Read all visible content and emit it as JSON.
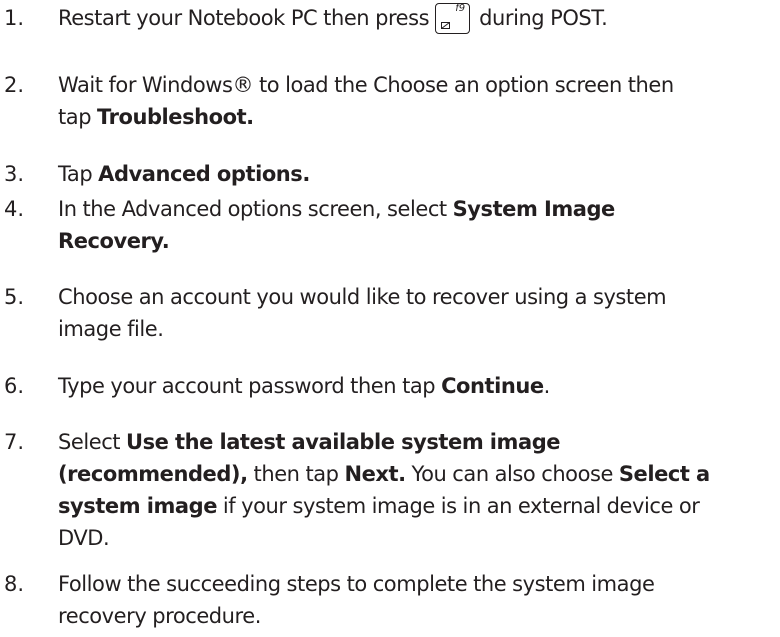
{
  "steps": [
    {
      "number": "1.",
      "lines": [
        {
          "before": "Restart your Notebook PC then press",
          "key": {
            "label": "f9",
            "icon": "fn-key-icon"
          },
          "after": "during POST."
        }
      ]
    },
    {
      "number": "2.",
      "lines": [
        {
          "plain": "Wait for Windows® to load the Choose an option screen then"
        },
        {
          "plain": "tap ",
          "bold": "Troubleshoot."
        }
      ]
    },
    {
      "number": "3.",
      "lines": [
        {
          "plain": "Tap ",
          "bold": "Advanced options."
        }
      ]
    },
    {
      "number": "4.",
      "lines": [
        {
          "plain": "In the Advanced options screen, select ",
          "bold": "System Image"
        },
        {
          "bold": "Recovery."
        }
      ]
    },
    {
      "number": "5.",
      "lines": [
        {
          "plain": "Choose an account you would like to recover using a system"
        },
        {
          "plain": "image file."
        }
      ]
    },
    {
      "number": "6.",
      "lines": [
        {
          "plain": "Type your account password then tap ",
          "bold": "Continue",
          "tail": "."
        }
      ]
    },
    {
      "number": "7.",
      "lines": [
        {
          "plain": "Select ",
          "bold": "Use the latest available system image"
        },
        {
          "bold": "(recommended),",
          "mid": " then tap ",
          "bold2": "Next.",
          "mid2": " You can also choose ",
          "bold3": "Select a"
        },
        {
          "bold": "system image",
          "tail": " if your system image is in an external device or"
        },
        {
          "plain": "DVD."
        }
      ]
    },
    {
      "number": "8.",
      "lines": [
        {
          "plain": "Follow the succeeding steps to complete the system image"
        },
        {
          "plain": "recovery procedure."
        }
      ]
    }
  ]
}
